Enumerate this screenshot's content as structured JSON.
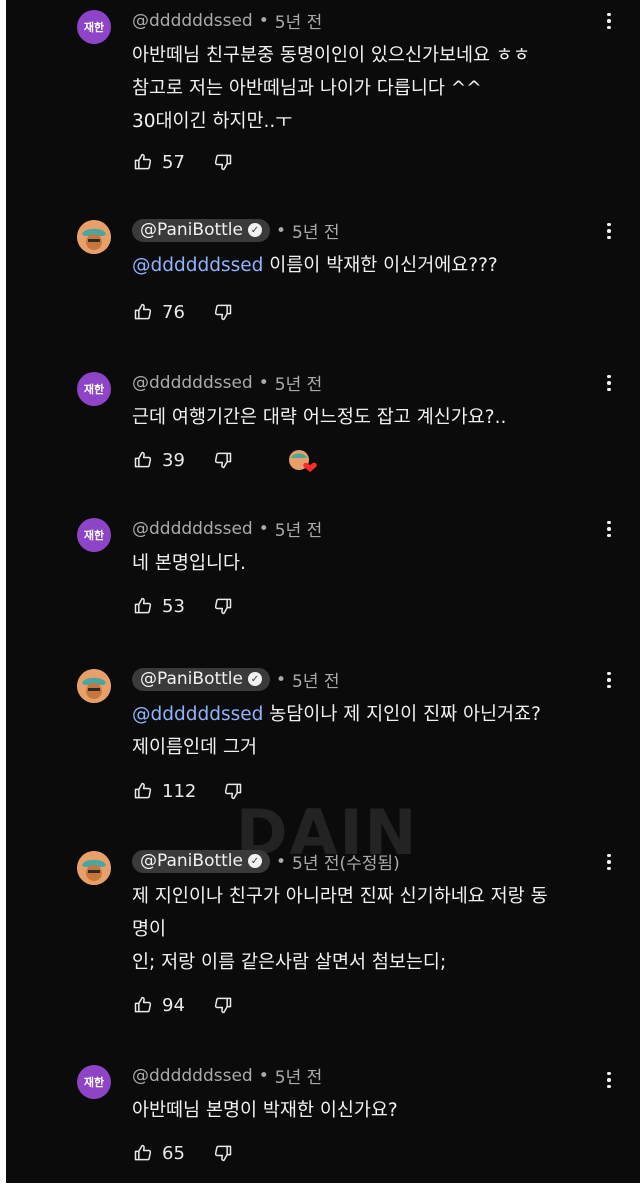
{
  "comments": [
    {
      "avatar_label": "재한",
      "handle": "@ddddddssed",
      "time": "5년 전",
      "mention": "",
      "lines": [
        "아반떼님 친구분중 동명이인이 있으신가보네요 ㅎㅎ",
        "참고로 저는 아반떼님과 나이가 다릅니다 ^^",
        "30대이긴 하지만..ㅜ"
      ],
      "likes": "57"
    },
    {
      "avatar_label": "",
      "handle": "@PaniBottle",
      "time": "5년 전",
      "mention": "@ddddddssed",
      "lines": [
        "이름이 박재한 이신거에요???"
      ],
      "likes": "76"
    },
    {
      "avatar_label": "재한",
      "handle": "@ddddddssed",
      "time": "5년 전",
      "mention": "",
      "lines": [
        "근데 여행기간은 대략 어느정도 잡고 계신가요?.."
      ],
      "likes": "39"
    },
    {
      "avatar_label": "재한",
      "handle": "@ddddddssed",
      "time": "5년 전",
      "mention": "",
      "lines": [
        "네 본명입니다."
      ],
      "likes": "53"
    },
    {
      "avatar_label": "",
      "handle": "@PaniBottle",
      "time": "5년 전",
      "mention": "@ddddddssed",
      "lines": [
        "농담이나 제 지인이 진짜 아닌거죠?",
        "제이름인데 그거"
      ],
      "likes": "112"
    },
    {
      "avatar_label": "",
      "handle": "@PaniBottle",
      "time": "5년 전(수정됨)",
      "mention": "",
      "lines": [
        "제 지인이나 친구가 아니라면 진짜 신기하네요 저랑 동",
        "명이",
        "인; 저랑 이름 같은사람 살면서 첨보는디;"
      ],
      "likes": "94"
    },
    {
      "avatar_label": "재한",
      "handle": "@ddddddssed",
      "time": "5년 전",
      "mention": "",
      "lines": [
        "아반떼님 본명이 박재한 이신가요?"
      ],
      "likes": "65"
    }
  ],
  "watermark": "DAIN",
  "colors": {
    "background": "#0b0b0b",
    "text": "#f1f1f1",
    "meta": "#aaaaaa",
    "mention": "#8fb4ff",
    "initials_avatar": "#8e44c7",
    "chip": "#3a3a3a"
  },
  "icons": [
    "thumbs-up-icon",
    "thumbs-down-icon",
    "more-vert-icon",
    "verified-check-icon",
    "creator-heart-icon"
  ]
}
